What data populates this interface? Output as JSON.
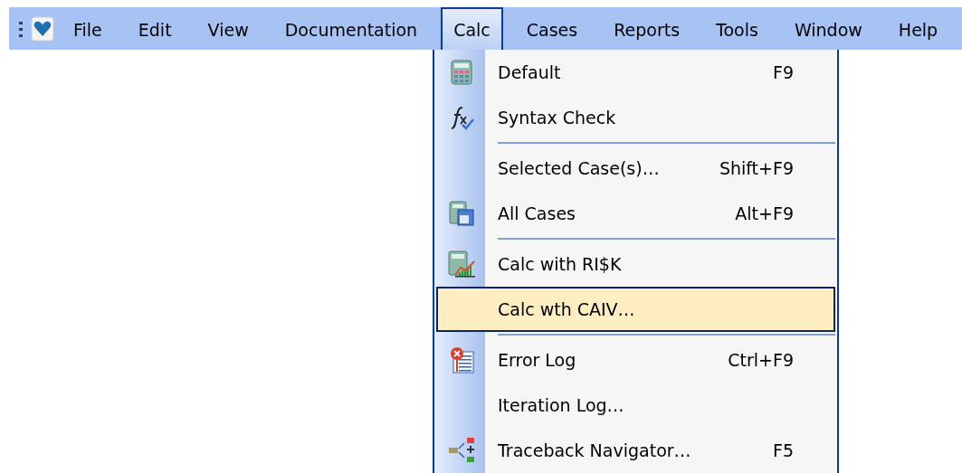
{
  "menubar": {
    "items": [
      {
        "label": "File",
        "selected": false
      },
      {
        "label": "Edit",
        "selected": false
      },
      {
        "label": "View",
        "selected": false
      },
      {
        "label": "Documentation",
        "selected": false
      },
      {
        "label": "Calc",
        "selected": true
      },
      {
        "label": "Cases",
        "selected": false
      },
      {
        "label": "Reports",
        "selected": false
      },
      {
        "label": "Tools",
        "selected": false
      },
      {
        "label": "Window",
        "selected": false
      },
      {
        "label": "Help",
        "selected": false
      }
    ]
  },
  "calc_menu": {
    "entries": [
      {
        "kind": "item",
        "label": "Default",
        "shortcut": "F9",
        "selected": false
      },
      {
        "kind": "item",
        "label": "Syntax Check",
        "selected": false
      },
      {
        "kind": "separator"
      },
      {
        "kind": "item",
        "label": "Selected Case(s)…",
        "shortcut": "Shift+F9",
        "selected": false
      },
      {
        "kind": "item",
        "label": "All Cases",
        "shortcut": "Alt+F9",
        "selected": false
      },
      {
        "kind": "separator"
      },
      {
        "kind": "item",
        "label": "Calc with RI$K",
        "selected": false
      },
      {
        "kind": "item",
        "label": "Calc wth CAIV…",
        "selected": true
      },
      {
        "kind": "separator"
      },
      {
        "kind": "item",
        "label": "Error Log",
        "shortcut": "Ctrl+F9",
        "selected": false
      },
      {
        "kind": "item",
        "label": "Iteration Log…",
        "selected": false
      },
      {
        "kind": "item",
        "label": "Traceback Navigator…",
        "shortcut": "F5",
        "selected": false
      }
    ]
  }
}
